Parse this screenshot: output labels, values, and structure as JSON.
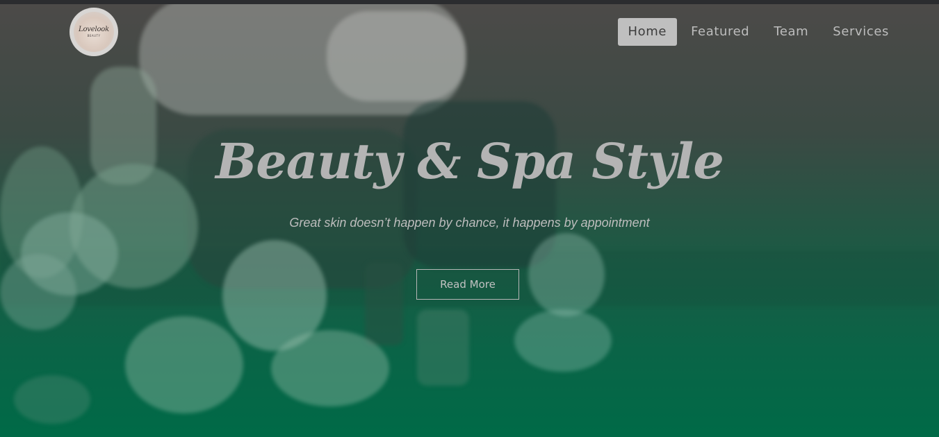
{
  "logo": {
    "script_text": "Lovelook",
    "sub_text": "BEAUTY"
  },
  "nav": {
    "items": [
      {
        "label": "Home",
        "active": true
      },
      {
        "label": "Featured",
        "active": false
      },
      {
        "label": "Team",
        "active": false
      },
      {
        "label": "Services",
        "active": false
      }
    ]
  },
  "hero": {
    "title": "Beauty & Spa Style",
    "subtitle": "Great skin doesn’t happen by chance, it happens by appointment",
    "cta_label": "Read More"
  },
  "colors": {
    "accent_green": "#006a47",
    "nav_active_bg": "#bfbfbf",
    "text_light": "#bdbdbd"
  }
}
